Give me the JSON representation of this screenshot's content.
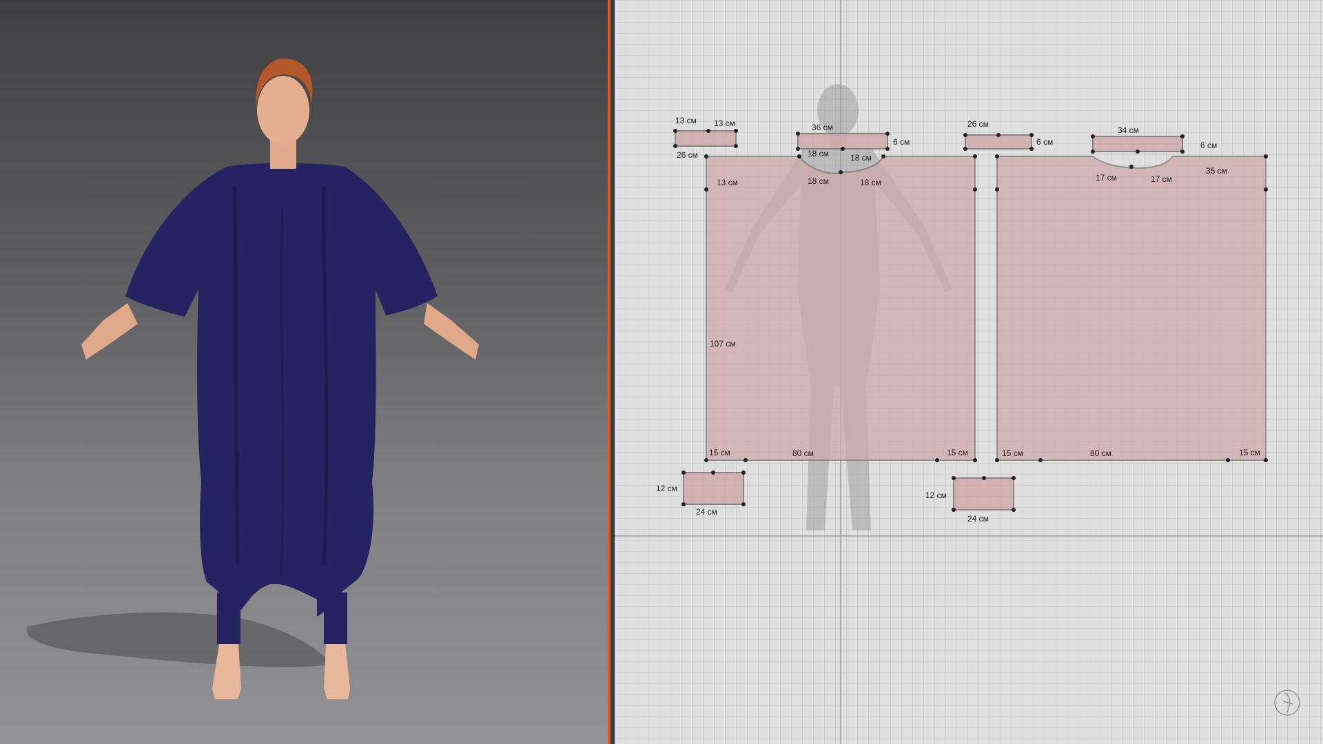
{
  "colors": {
    "accent_divider": "#e2591f",
    "garment": "#262363",
    "pattern_piece_fill": "#cfa9a9",
    "pattern_piece_stroke": "#777777"
  },
  "avatar_view": {
    "icons": [
      "avatar-icon",
      "garment-icon"
    ]
  },
  "pattern_view": {
    "measurements": {
      "collar_left_side": "13 см",
      "collar_left_top": "13 см",
      "collar_left_bottom": "26 см",
      "front_neck_band": "36 см",
      "front_neck_band_height": "6 см",
      "front_neck_left": "18 см",
      "front_neck_right": "18 см",
      "front_neck_curve_left": "18 см",
      "front_neck_curve_right": "18 см",
      "front_shoulder": "13 см",
      "front_length": "107 см",
      "front_hem_left": "15 см",
      "front_hem_mid": "80 см",
      "front_hem_right": "15 см",
      "back_collar_top": "26 см",
      "back_collar_height": "6 см",
      "back_neck_band": "34 см",
      "back_neck_band_height": "6 см",
      "back_neck_left": "17 см",
      "back_neck_right": "17 см",
      "back_shoulder": "35 см",
      "back_hem_left": "15 см",
      "back_hem_mid": "80 см",
      "back_hem_right": "15 см",
      "cuff_left_height": "12 см",
      "cuff_left_width": "24 см",
      "cuff_right_height": "12 см",
      "cuff_right_width": "24 см"
    },
    "logo": "watermark-logo-icon"
  }
}
